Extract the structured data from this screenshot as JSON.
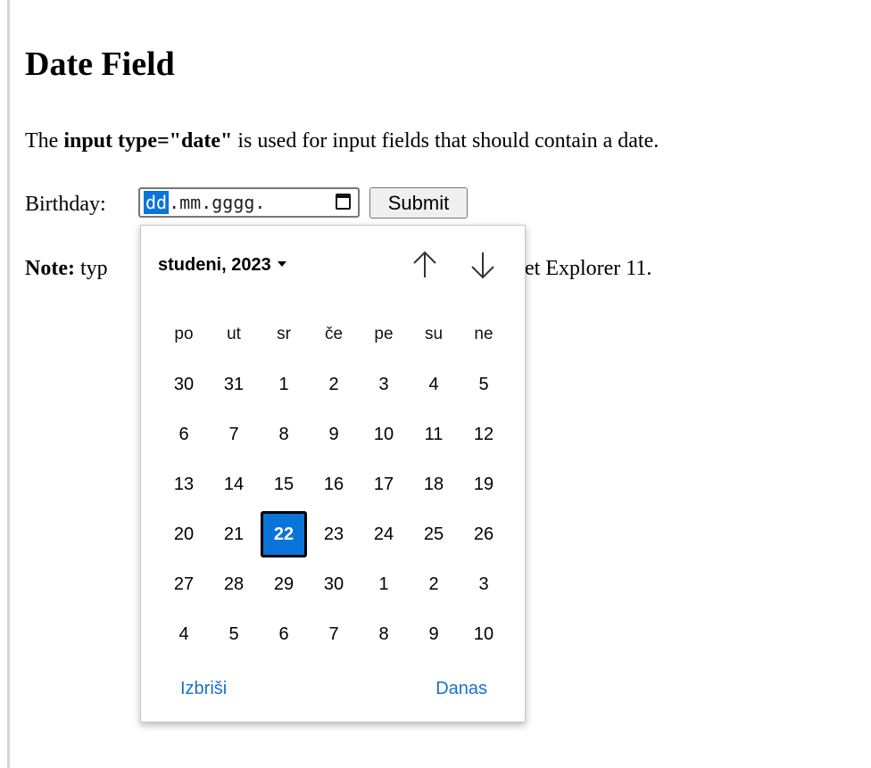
{
  "page": {
    "title": "Date Field",
    "intro": {
      "prefix": "The ",
      "code": "input type=\"date\"",
      "suffix": " is used for input fields that should contain a date."
    },
    "note": {
      "label": "Note:",
      "text_visible_left": " typ",
      "text_visible_right": "et Explorer 11."
    }
  },
  "form": {
    "birthday_label": "Birthday:",
    "date_input": {
      "day_segment": "dd",
      "rest": ".mm.gggg.",
      "icon": "calendar-icon"
    },
    "submit_label": "Submit"
  },
  "picker": {
    "month_label": "studeni, 2023",
    "nav_up_icon": "arrow-up-icon",
    "nav_down_icon": "arrow-down-icon",
    "weekdays": [
      "po",
      "ut",
      "sr",
      "če",
      "pe",
      "su",
      "ne"
    ],
    "weeks": [
      [
        {
          "d": "30",
          "o": true
        },
        {
          "d": "31",
          "o": true
        },
        {
          "d": "1"
        },
        {
          "d": "2"
        },
        {
          "d": "3"
        },
        {
          "d": "4"
        },
        {
          "d": "5"
        }
      ],
      [
        {
          "d": "6"
        },
        {
          "d": "7"
        },
        {
          "d": "8"
        },
        {
          "d": "9"
        },
        {
          "d": "10"
        },
        {
          "d": "11"
        },
        {
          "d": "12"
        }
      ],
      [
        {
          "d": "13"
        },
        {
          "d": "14"
        },
        {
          "d": "15"
        },
        {
          "d": "16"
        },
        {
          "d": "17"
        },
        {
          "d": "18"
        },
        {
          "d": "19"
        }
      ],
      [
        {
          "d": "20"
        },
        {
          "d": "21"
        },
        {
          "d": "22",
          "sel": true
        },
        {
          "d": "23"
        },
        {
          "d": "24"
        },
        {
          "d": "25"
        },
        {
          "d": "26"
        }
      ],
      [
        {
          "d": "27"
        },
        {
          "d": "28"
        },
        {
          "d": "29"
        },
        {
          "d": "30"
        },
        {
          "d": "1",
          "o": true
        },
        {
          "d": "2",
          "o": true
        },
        {
          "d": "3",
          "o": true
        }
      ],
      [
        {
          "d": "4",
          "o": true
        },
        {
          "d": "5",
          "o": true
        },
        {
          "d": "6",
          "o": true
        },
        {
          "d": "7",
          "o": true
        },
        {
          "d": "8",
          "o": true
        },
        {
          "d": "9",
          "o": true
        },
        {
          "d": "10",
          "o": true
        }
      ]
    ],
    "clear_label": "Izbriši",
    "today_label": "Danas"
  },
  "colors": {
    "accent": "#0a74d8",
    "link": "#1a6fd0",
    "muted_day": "#777777"
  }
}
